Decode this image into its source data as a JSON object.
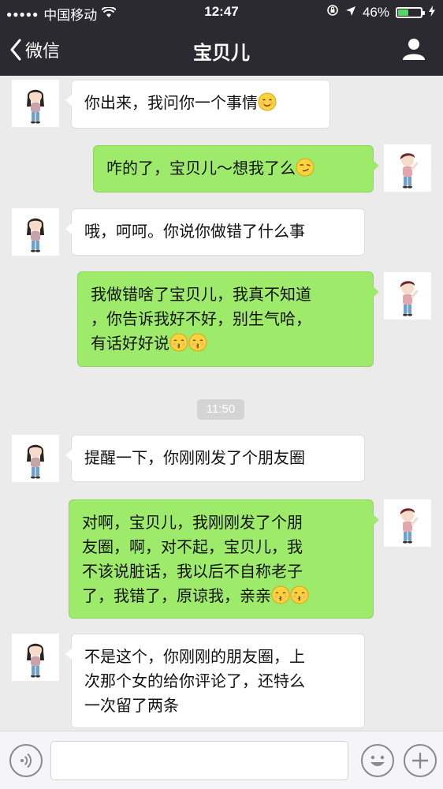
{
  "status_bar": {
    "carrier": "中国移动",
    "time": "12:47",
    "battery_percent": "46%",
    "battery_level": 0.46
  },
  "nav": {
    "back_label": "微信",
    "title": "宝贝儿"
  },
  "messages": [
    {
      "side": "left",
      "text": "你出来，我问你一个事情",
      "emoji": [
        "smile-emoji"
      ]
    },
    {
      "side": "right",
      "text": "咋的了，宝贝儿～想我了么",
      "emoji": [
        "smirk-emoji"
      ]
    },
    {
      "side": "left",
      "text": "哦，呵呵。你说你做错了什么事",
      "emoji": []
    },
    {
      "side": "right",
      "lines": [
        "我做错啥了宝贝儿，我真不知道",
        "，你告诉我好不好，别生气哈，",
        "有话好好说"
      ],
      "emoji": [
        "kiss-emoji",
        "kiss-emoji"
      ]
    },
    {
      "side": "left",
      "text": "提醒一下，你刚刚发了个朋友圈",
      "emoji": []
    },
    {
      "side": "right",
      "lines": [
        "对啊，宝贝儿，我刚刚发了个朋",
        "友圈，啊，对不起，宝贝儿，我",
        "不该说脏话，我以后不自称老子",
        "了，我错了，原谅我，亲亲"
      ],
      "emoji": [
        "kiss-emoji",
        "kiss-emoji"
      ]
    },
    {
      "side": "left",
      "lines": [
        "不是这个，你刚刚的朋友圈，上",
        "次那个女的给你评论了，还特么",
        "一次留了两条"
      ],
      "emoji": []
    }
  ],
  "timestamp": "11:50",
  "colors": {
    "header_bg": "#2b2a30",
    "chat_bg": "#ebebeb",
    "sent_bubble": "#9eea6a",
    "received_bubble": "#ffffff"
  }
}
